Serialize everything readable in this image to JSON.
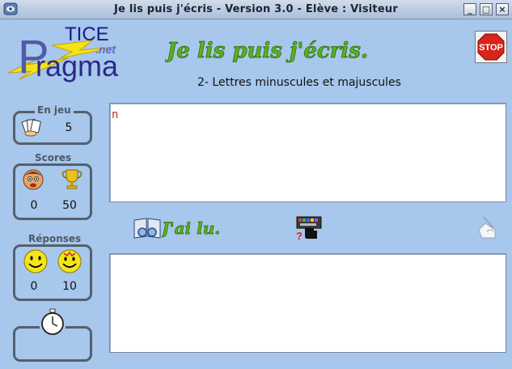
{
  "window": {
    "title": "Je lis puis j'écris - Version 3.0 - Elève : Visiteur"
  },
  "window_buttons": {
    "minimize": "_",
    "maximize": "□",
    "close": "×"
  },
  "logo": {
    "line1": "TICE",
    "line2": ".net",
    "first_letter": "P",
    "rest": "ragma"
  },
  "heading": {
    "title": "Je lis puis j'écris.",
    "subtitle": "2- Lettres minuscules et majuscules"
  },
  "stop_button": {
    "label": "STOP"
  },
  "panels": {
    "en_jeu": {
      "label": "En jeu",
      "value": "5"
    },
    "scores": {
      "label": "Scores",
      "left_value": "0",
      "right_value": "50"
    },
    "reponses": {
      "label": "Réponses",
      "left_value": "0",
      "right_value": "10"
    }
  },
  "reading_box": {
    "text": "n"
  },
  "actions": {
    "jai_lu": "J'ai lu."
  },
  "writing_box": {
    "text": ""
  },
  "colors": {
    "background": "#a7c7ec",
    "title_green": "#5bb020",
    "typed_text": "#c0302a",
    "stop_red": "#d7241c"
  }
}
